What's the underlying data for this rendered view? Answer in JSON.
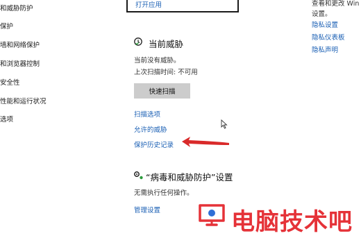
{
  "sidebar": {
    "items": [
      {
        "label": "和威胁防护"
      },
      {
        "label": "保护"
      },
      {
        "label": "墙和网络保护"
      },
      {
        "label": "和浏览器控制"
      },
      {
        "label": "安全性"
      },
      {
        "label": "性能和运行状况"
      },
      {
        "label": "选项"
      }
    ]
  },
  "top_box": {
    "link": "打开应用"
  },
  "current_threats": {
    "title": "当前威胁",
    "no_threats": "当前没有威胁。",
    "last_scan": "上次扫描时间: 不可用",
    "quick_scan_button": "快速扫描",
    "links": [
      "扫描选项",
      "允许的威胁",
      "保护历史记录"
    ]
  },
  "virus_settings": {
    "title": "“病毒和威胁防护”设置",
    "status": "无需执行任何操作。",
    "manage_link": "管理设置"
  },
  "right_panel": {
    "line1": "查看和更改 Win",
    "line2": "设置。",
    "links": [
      "隐私设置",
      "隐私仪表板",
      "隐私声明"
    ]
  },
  "watermark": {
    "text": "电脑技术吧"
  },
  "colors": {
    "link": "#1a5fb4",
    "arrow": "#d92a2a",
    "watermark": "#e53238",
    "button": "#cccccc"
  }
}
